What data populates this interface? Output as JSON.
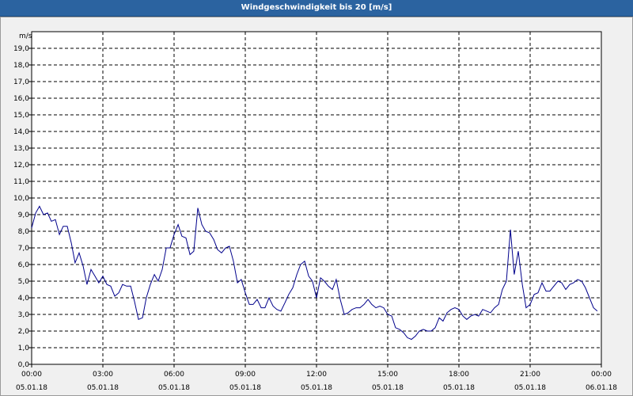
{
  "window": {
    "title": "Windgeschwindigkeit bis 20 [m/s]"
  },
  "chart_data": {
    "type": "line",
    "title": "Windgeschwindigkeit bis 20 [m/s]",
    "ylabel": "m/s",
    "ylim": [
      0,
      20
    ],
    "xlim_hours": [
      0,
      24
    ],
    "grid": true,
    "line_color": "#00008b",
    "y_ticks": [
      "0,0",
      "1,0",
      "2,0",
      "3,0",
      "4,0",
      "5,0",
      "6,0",
      "7,0",
      "8,0",
      "9,0",
      "10,0",
      "11,0",
      "12,0",
      "13,0",
      "14,0",
      "15,0",
      "16,0",
      "17,0",
      "18,0",
      "19,0"
    ],
    "x_ticks": [
      {
        "time": "00:00",
        "date": "05.01.18"
      },
      {
        "time": "03:00",
        "date": "05.01.18"
      },
      {
        "time": "06:00",
        "date": "05.01.18"
      },
      {
        "time": "09:00",
        "date": "05.01.18"
      },
      {
        "time": "12:00",
        "date": "05.01.18"
      },
      {
        "time": "15:00",
        "date": "05.01.18"
      },
      {
        "time": "18:00",
        "date": "05.01.18"
      },
      {
        "time": "21:00",
        "date": "05.01.18"
      },
      {
        "time": "00:00",
        "date": "06.01.18"
      }
    ],
    "series": [
      {
        "x_hours": [
          0,
          0.17,
          0.33,
          0.5,
          0.67,
          0.83,
          1,
          1.17,
          1.33,
          1.5,
          1.67,
          1.83,
          2,
          2.17,
          2.33,
          2.5,
          2.67,
          2.83,
          3,
          3.17,
          3.33,
          3.5,
          3.67,
          3.83,
          4,
          4.17,
          4.33,
          4.5,
          4.67,
          4.83,
          5,
          5.17,
          5.33,
          5.5,
          5.67,
          5.83,
          6,
          6.17,
          6.33,
          6.5,
          6.67,
          6.83,
          7,
          7.17,
          7.33,
          7.5,
          7.67,
          7.83,
          8,
          8.17,
          8.33,
          8.5,
          8.67,
          8.83,
          9,
          9.17,
          9.33,
          9.5,
          9.67,
          9.83,
          10,
          10.17,
          10.33,
          10.5,
          10.67,
          10.83,
          11,
          11.17,
          11.33,
          11.5,
          11.67,
          11.83,
          12,
          12.17,
          12.33,
          12.5,
          12.67,
          12.83,
          13,
          13.17,
          13.33,
          13.5,
          13.67,
          13.83,
          14,
          14.17,
          14.33,
          14.5,
          14.67,
          14.83,
          15,
          15.17,
          15.33,
          15.5,
          15.67,
          15.83,
          16,
          16.17,
          16.33,
          16.5,
          16.67,
          16.83,
          17,
          17.17,
          17.33,
          17.5,
          17.67,
          17.83,
          18,
          18.17,
          18.33,
          18.5,
          18.67,
          18.83,
          19,
          19.17,
          19.33,
          19.5,
          19.67,
          19.83,
          20,
          20.17,
          20.33,
          20.5,
          20.67,
          20.83,
          21,
          21.17,
          21.33,
          21.5,
          21.67,
          21.83,
          22,
          22.17,
          22.33,
          22.5,
          22.67,
          22.83,
          23,
          23.17,
          23.33,
          23.5,
          23.67,
          23.83
        ],
        "values": [
          8.2,
          9.1,
          9.5,
          9.0,
          9.1,
          8.6,
          8.7,
          7.8,
          8.3,
          8.3,
          7.3,
          6.1,
          6.7,
          5.9,
          4.8,
          5.7,
          5.3,
          4.9,
          5.3,
          4.8,
          4.7,
          4.1,
          4.3,
          4.8,
          4.7,
          4.7,
          3.8,
          2.7,
          2.8,
          4.0,
          4.8,
          5.4,
          5.0,
          5.7,
          7.0,
          7.0,
          7.8,
          8.4,
          7.7,
          7.6,
          6.6,
          6.8,
          9.4,
          8.4,
          8.0,
          7.9,
          7.5,
          6.9,
          6.7,
          7.0,
          7.1,
          6.2,
          4.9,
          5.1,
          4.3,
          3.6,
          3.6,
          3.9,
          3.4,
          3.4,
          4.0,
          3.5,
          3.3,
          3.2,
          3.7,
          4.2,
          4.6,
          5.4,
          6.0,
          6.2,
          5.3,
          5.0,
          4.0,
          5.2,
          5.0,
          4.7,
          4.5,
          5.1,
          3.9,
          3.0,
          3.1,
          3.3,
          3.4,
          3.4,
          3.6,
          3.9,
          3.6,
          3.4,
          3.5,
          3.4,
          3.0,
          2.9,
          2.2,
          2.1,
          1.9,
          1.6,
          1.5,
          1.7,
          2.0,
          2.1,
          2.0,
          2.0,
          2.2,
          2.8,
          2.6,
          3.1,
          3.3,
          3.4,
          3.3,
          2.9,
          2.7,
          2.9,
          3.0,
          2.9,
          3.3,
          3.2,
          3.1,
          3.4,
          3.6,
          4.5,
          5.0,
          8.1,
          5.4,
          6.8,
          4.8,
          3.4,
          3.6,
          4.2,
          4.3,
          4.9,
          4.4,
          4.4,
          4.7,
          5.0,
          4.9,
          4.5,
          4.8,
          4.9,
          5.1,
          5.0,
          4.6,
          4.0,
          3.4,
          3.2
        ]
      }
    ]
  }
}
